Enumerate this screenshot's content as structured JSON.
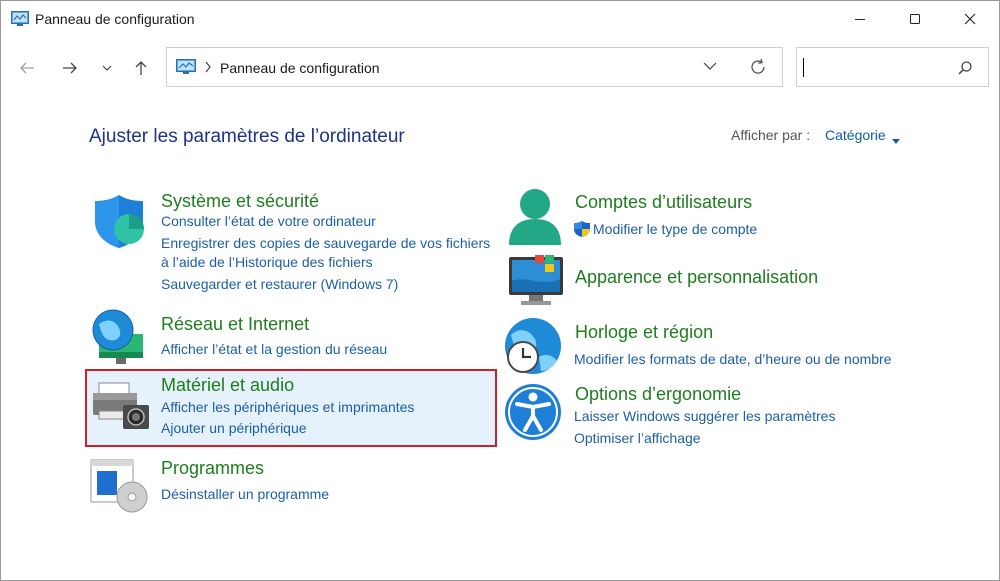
{
  "window": {
    "title": "Panneau de configuration"
  },
  "address": {
    "path": "Panneau de configuration"
  },
  "search": {
    "placeholder": ""
  },
  "header": {
    "title": "Ajuster les paramètres de l’ordinateur",
    "view_label": "Afficher par :",
    "view_value": "Catégorie"
  },
  "left": [
    {
      "title": "Système et sécurité",
      "links": [
        "Consulter l’état de votre ordinateur",
        "Enregistrer des copies de sauvegarde de vos fichiers",
        "à l’aide de l’Historique des fichiers",
        "Sauvegarder et restaurer (Windows 7)"
      ]
    },
    {
      "title": "Réseau et Internet",
      "links": [
        "Afficher l’état et la gestion du réseau"
      ]
    },
    {
      "title": "Matériel et audio",
      "links": [
        "Afficher les périphériques et imprimantes",
        "Ajouter un périphérique"
      ]
    },
    {
      "title": "Programmes",
      "links": [
        "Désinstaller un programme"
      ]
    }
  ],
  "right": [
    {
      "title": "Comptes d’utilisateurs",
      "links": [
        "Modifier le type de compte"
      ]
    },
    {
      "title": "Apparence et personnalisation",
      "links": []
    },
    {
      "title": "Horloge et région",
      "links": [
        "Modifier les formats de date, d’heure ou de nombre"
      ]
    },
    {
      "title": "Options d’ergonomie",
      "links": [
        "Laisser Windows suggérer les paramètres",
        "Optimiser l’affichage"
      ]
    }
  ],
  "icons": {
    "system": "shield-icon",
    "network": "network-globe-icon",
    "hardware": "printer-icon",
    "programs": "programs-icon",
    "users": "user-icon",
    "appearance": "monitor-icon",
    "clock": "clock-globe-icon",
    "ease": "accessibility-icon",
    "uac": "uac-shield-icon"
  },
  "colors": {
    "heading": "#1e3287",
    "category_title": "#1e7d1e",
    "link": "#1c5fa6",
    "highlight_border": "#d0202a",
    "highlight_fill": "#e5f1fb"
  }
}
